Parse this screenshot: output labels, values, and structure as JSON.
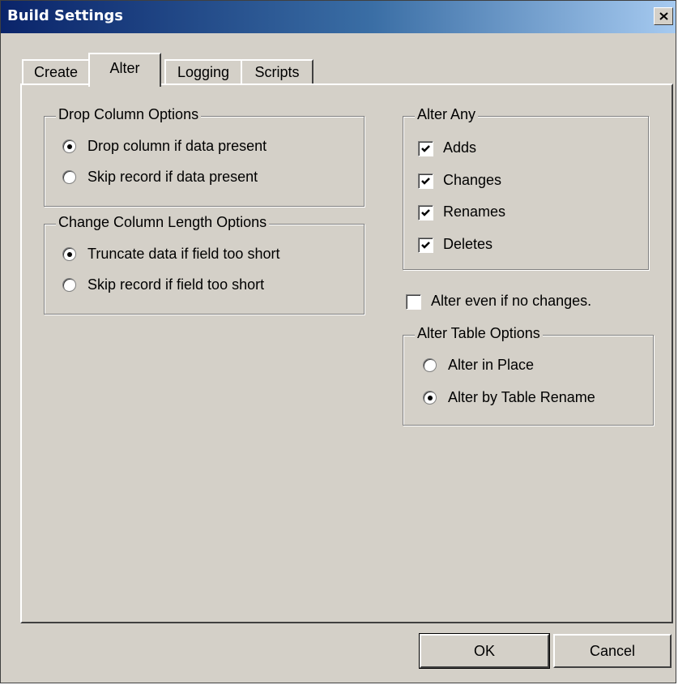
{
  "window": {
    "title": "Build Settings"
  },
  "tabs": [
    {
      "label": "Create"
    },
    {
      "label": "Alter"
    },
    {
      "label": "Logging"
    },
    {
      "label": "Scripts"
    }
  ],
  "active_tab": "Alter",
  "drop_column": {
    "title": "Drop Column Options",
    "options": [
      {
        "label": "Drop column if data present",
        "selected": true
      },
      {
        "label": "Skip record if data present",
        "selected": false
      }
    ]
  },
  "change_length": {
    "title": "Change Column Length Options",
    "options": [
      {
        "label": "Truncate data if field too short",
        "selected": true
      },
      {
        "label": "Skip record if field too short",
        "selected": false
      }
    ]
  },
  "alter_any": {
    "title": "Alter Any",
    "items": [
      {
        "label": "Adds",
        "checked": true
      },
      {
        "label": "Changes",
        "checked": true
      },
      {
        "label": "Renames",
        "checked": true
      },
      {
        "label": "Deletes",
        "checked": true
      }
    ]
  },
  "alter_even": {
    "label": "Alter even if no changes.",
    "checked": false
  },
  "alter_table": {
    "title": "Alter Table Options",
    "options": [
      {
        "label": "Alter in Place",
        "selected": false
      },
      {
        "label": "Alter by Table Rename",
        "selected": true
      }
    ]
  },
  "buttons": {
    "ok": "OK",
    "cancel": "Cancel"
  }
}
